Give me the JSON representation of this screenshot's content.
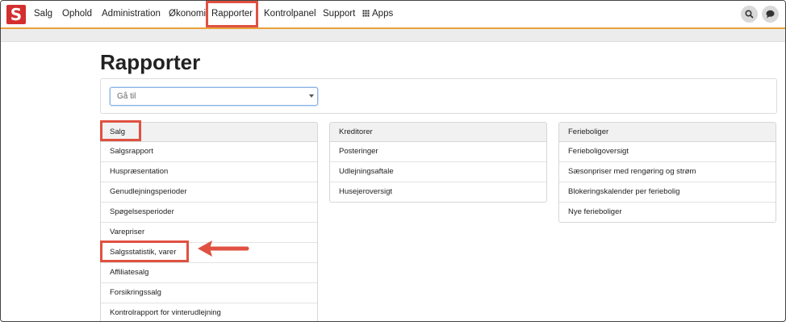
{
  "navbar": {
    "logo_letter": "S",
    "items": [
      "Salg",
      "Ophold",
      "Administration",
      "Økonomi",
      "Rapporter",
      "Kontrolpanel",
      "Support",
      "Apps"
    ],
    "search_icon": "search-icon",
    "chat_icon": "chat-icon"
  },
  "page": {
    "title": "Rapporter",
    "goto_placeholder": "Gå til"
  },
  "columns": [
    {
      "header": "Salg",
      "items": [
        "Salgsrapport",
        "Huspræsentation",
        "Genudlejningsperioder",
        "Spøgelsesperioder",
        "Varepriser",
        "Salgsstatistik, varer",
        "Affiliatesalg",
        "Forsikringssalg",
        "Kontrolrapport for vinterudlejning"
      ]
    },
    {
      "header": "Kreditorer",
      "items": [
        "Posteringer",
        "Udlejningsaftale",
        "Husejeroversigt"
      ]
    },
    {
      "header": "Ferieboliger",
      "items": [
        "Ferieboligoversigt",
        "Sæsonpriser med rengøring og strøm",
        "Blokeringskalender per feriebolig",
        "Nye ferieboliger"
      ]
    }
  ],
  "colors": {
    "highlight": "#e05141",
    "accent_line": "#e8a13a",
    "logo": "#d32f2f"
  }
}
